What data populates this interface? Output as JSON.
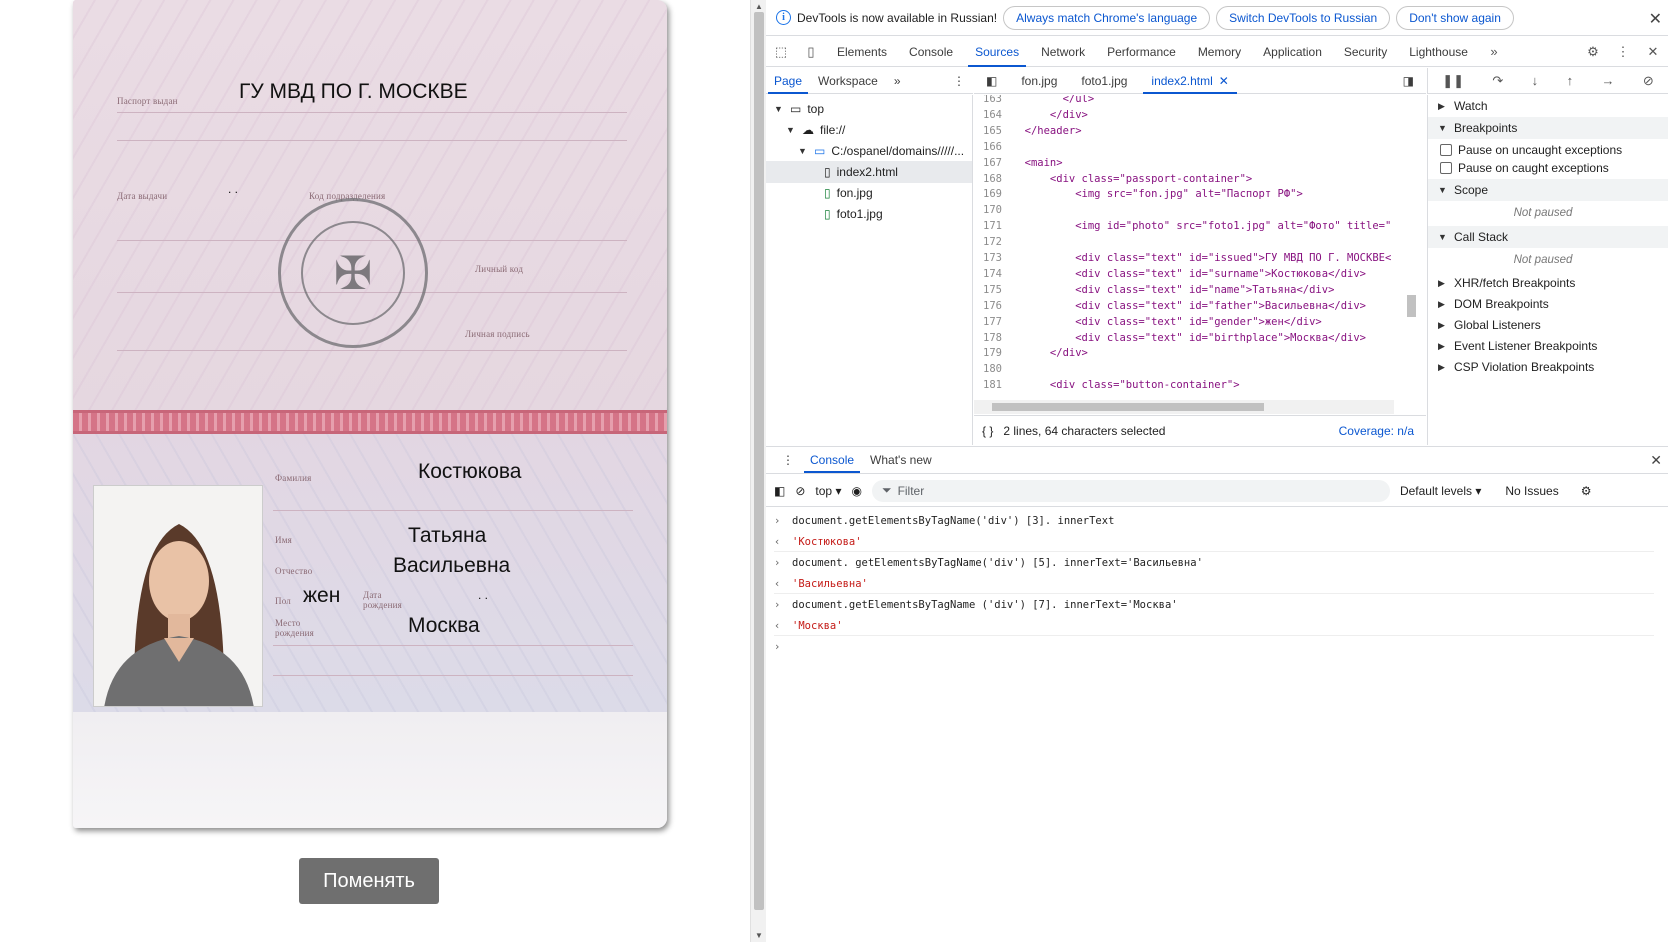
{
  "passport": {
    "issued_label": "Паспорт выдан",
    "issued_value": "ГУ МВД ПО Г. МОСКВЕ",
    "date_label": "Дата выдачи",
    "date_value": ". .",
    "code_label": "Код подразделения",
    "personal_code_label": "Личный код",
    "signature_label": "Личная подпись",
    "surname_label": "Фамилия",
    "surname_value": "Костюкова",
    "name_label": "Имя",
    "name_value": "Татьяна",
    "patronymic_label": "Отчество",
    "patronymic_value": "Васильевна",
    "gender_label": "Пол",
    "gender_value": "жен",
    "birthdate_label": "Дата рождения",
    "birthdate_value": ". .",
    "birthplace_label": "Место рождения",
    "birthplace_value": "Москва"
  },
  "page": {
    "change_button": "Поменять"
  },
  "devtools": {
    "infobar": {
      "text": "DevTools is now available in Russian!",
      "btn_match": "Always match Chrome's language",
      "btn_switch": "Switch DevTools to Russian",
      "btn_dont": "Don't show again"
    },
    "tabs": [
      "Elements",
      "Console",
      "Sources",
      "Network",
      "Performance",
      "Memory",
      "Application",
      "Security",
      "Lighthouse"
    ],
    "active_tab": "Sources",
    "sources": {
      "nav_tabs": [
        "Page",
        "Workspace"
      ],
      "tree": {
        "top": "top",
        "origin": "file://",
        "folder": "C:/ospanel/domains/////...",
        "files": [
          "index2.html",
          "fon.jpg",
          "foto1.jpg"
        ]
      },
      "editor_tabs": [
        "fon.jpg",
        "foto1.jpg",
        "index2.html"
      ],
      "active_editor_tab": "index2.html",
      "code_lines": [
        {
          "n": "163",
          "code": "        </ul>"
        },
        {
          "n": "164",
          "code": "      </div>"
        },
        {
          "n": "165",
          "code": "  </header>"
        },
        {
          "n": "166",
          "code": ""
        },
        {
          "n": "167",
          "code": "  <main>"
        },
        {
          "n": "168",
          "code": "      <div class=\"passport-container\">"
        },
        {
          "n": "169",
          "code": "          <img src=\"fon.jpg\" alt=\"Паспорт РФ\">"
        },
        {
          "n": "170",
          "code": ""
        },
        {
          "n": "171",
          "code": "          <img id=\"photo\" src=\"foto1.jpg\" alt=\"Фото\" title=\""
        },
        {
          "n": "172",
          "code": ""
        },
        {
          "n": "173",
          "code": "          <div class=\"text\" id=\"issued\">ГУ МВД ПО Г. МОСКВЕ<"
        },
        {
          "n": "174",
          "code": "          <div class=\"text\" id=\"surname\">Костюкова</div>"
        },
        {
          "n": "175",
          "code": "          <div class=\"text\" id=\"name\">Татьяна</div>"
        },
        {
          "n": "176",
          "code": "          <div class=\"text\" id=\"father\">Васильевна</div>"
        },
        {
          "n": "177",
          "code": "          <div class=\"text\" id=\"gender\">жен</div>"
        },
        {
          "n": "178",
          "code": "          <div class=\"text\" id=\"birthplace\">Москва</div>"
        },
        {
          "n": "179",
          "code": "      </div>"
        },
        {
          "n": "180",
          "code": ""
        },
        {
          "n": "181",
          "code": "      <div class=\"button-container\">"
        }
      ],
      "status": "2 lines, 64 characters selected",
      "coverage": "Coverage: n/a"
    },
    "debugger": {
      "watch": "Watch",
      "breakpoints": "Breakpoints",
      "pause_uncaught": "Pause on uncaught exceptions",
      "pause_caught": "Pause on caught exceptions",
      "scope": "Scope",
      "not_paused": "Not paused",
      "call_stack": "Call Stack",
      "sections": [
        "XHR/fetch Breakpoints",
        "DOM Breakpoints",
        "Global Listeners",
        "Event Listener Breakpoints",
        "CSP Violation Breakpoints"
      ]
    },
    "drawer": {
      "tabs": [
        "Console",
        "What's new"
      ],
      "context": "top",
      "filter_placeholder": "Filter",
      "levels": "Default levels",
      "issues": "No Issues",
      "log": [
        {
          "kind": "in",
          "text": "document.getElementsByTagName('div') [3]. innerText"
        },
        {
          "kind": "out",
          "text": "'Костюкова'"
        },
        {
          "kind": "in",
          "text": "document. getElementsByTagName('div') [5]. innerText='Васильевна'"
        },
        {
          "kind": "out",
          "text": "'Васильевна'"
        },
        {
          "kind": "in",
          "text": "document.getElementsByTagName ('div') [7]. innerText='Москва'"
        },
        {
          "kind": "out",
          "text": "'Москва'"
        }
      ]
    }
  }
}
